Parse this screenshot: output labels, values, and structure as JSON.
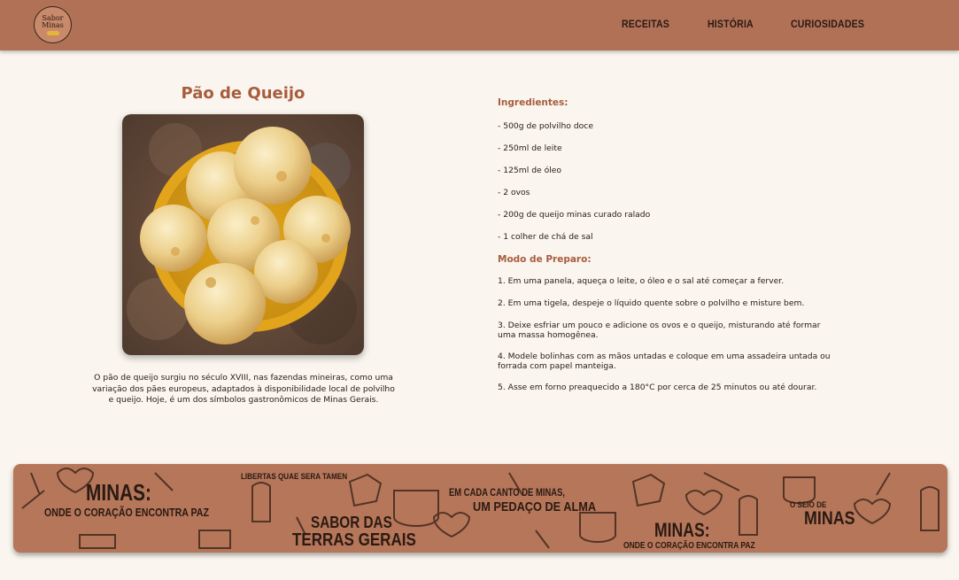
{
  "header": {
    "logo": {
      "line1": "Sabor",
      "line2": "Minas"
    },
    "nav": [
      "RECEITAS",
      "HISTÓRIA",
      "CURIOSIDADES"
    ]
  },
  "recipe": {
    "title": "Pão de Queijo",
    "description": "O pão de queijo surgiu no século XVIII, nas fazendas mineiras, como uma variação dos pães europeus, adaptados à disponibilidade local de polvilho e queijo. Hoje, é um dos símbolos gastronômicos de Minas Gerais.",
    "ingredients_label": "Ingredientes:",
    "ingredients": [
      "- 500g de polvilho doce",
      "- 250ml de leite",
      "- 125ml de óleo",
      "- 2 ovos",
      "- 200g de queijo minas curado ralado",
      "- 1 colher de chá de sal"
    ],
    "preparation_label": "Modo de Preparo:",
    "steps": [
      "1. Em uma panela, aqueça o leite, o óleo e o sal até começar a ferver.",
      "2. Em uma tigela, despeje o líquido quente sobre o polvilho e misture bem.",
      "3. Deixe esfriar um pouco e adicione os ovos e o queijo, misturando até formar uma massa homogênea.",
      "4. Modele bolinhas com as mãos untadas e coloque em uma assadeira untada ou forrada com papel manteiga.",
      "5. Asse em forno preaquecido a 180°C por cerca de 25 minutos ou até dourar."
    ]
  },
  "banner": {
    "minas1": "MINAS:",
    "minas1_sub": "ONDE O CORAÇÃO ENCONTRA PAZ",
    "libertas": "LIBERTAS QUAE SERA TAMEN",
    "sabor1": "SABOR DAS",
    "sabor2": "TERRAS GERAIS",
    "canto1": "EM CADA CANTO DE MINAS,",
    "canto2": "UM PEDAÇO DE ALMA",
    "minas2": "MINAS:",
    "minas2_sub": "ONDE O CORAÇÃO ENCONTRA PAZ",
    "seio": "O SEIO DE",
    "seio_minas": "MINAS"
  },
  "colors": {
    "header": "#b07157",
    "accent": "#a65d3e",
    "background": "#faf5ee",
    "banner": "#b6765a"
  }
}
